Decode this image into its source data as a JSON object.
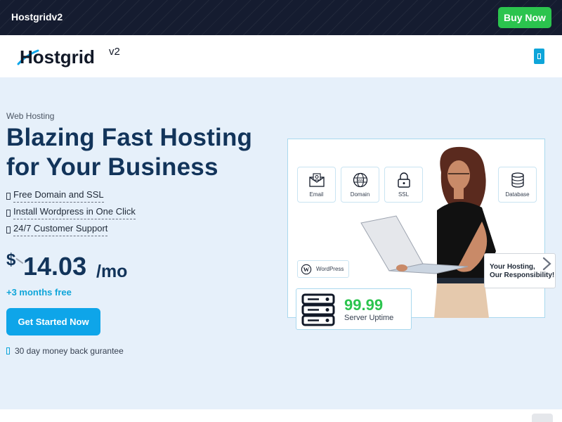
{
  "topbar": {
    "brand": "Hostgridv2",
    "buy_label": "Buy Now"
  },
  "logo": {
    "text": "Hostgrid",
    "suffix": "v2"
  },
  "hero": {
    "eyebrow": "Web Hosting",
    "headline_line1": "Blazing Fast Hosting",
    "headline_line2": "for Your Business",
    "features": [
      "Free Domain and SSL",
      "Install Wordpress in One Click",
      "24/7 Customer Support"
    ],
    "price": {
      "currency": "$",
      "amount": "14.03",
      "period": "/mo"
    },
    "bonus": "+3 months free",
    "cta_label": "Get Started Now",
    "guarantee": "30 day money back gurantee"
  },
  "illustration": {
    "cards": {
      "email": "Email",
      "domain": "Domain",
      "ssl": "SSL",
      "database": "Database"
    },
    "wordpress_label": "WordPress",
    "uptime_value": "99.99",
    "uptime_caption": "Server Uptime",
    "slogan_line1": "Your Hosting,",
    "slogan_line2": "Our Responsibility!"
  },
  "colors": {
    "accent": "#0ea5e9",
    "green": "#2bc44e",
    "navy": "#12345a",
    "topbar": "#151c30",
    "hero_bg": "#e6f0fa"
  },
  "icons": [
    "check-icon",
    "shield-icon",
    "email-icon",
    "globe-icon",
    "lock-icon",
    "database-icon",
    "wordpress-icon",
    "server-icon",
    "chevron-right-icon",
    "menu-icon"
  ]
}
